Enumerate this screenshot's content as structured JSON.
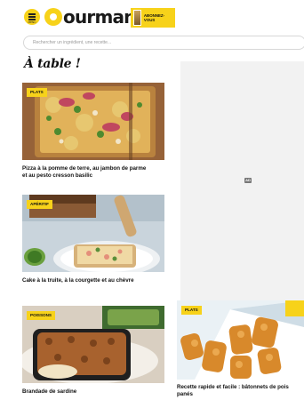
{
  "header": {
    "menu_label": "MENU",
    "logo_text": "ourmand",
    "subscribe_label": "ABONNEZ-VOUS"
  },
  "search": {
    "placeholder": "Rechercher un ingrédient, une recette..."
  },
  "section": {
    "title": "À table !"
  },
  "ad": {
    "badge": "AD"
  },
  "cards": [
    {
      "tag": "PLATS",
      "title_line1": "Pizza à la pomme de terre, au jambon de parme",
      "title_line2": "et au pesto cresson basilic"
    },
    {
      "tag": "APÉRITIF",
      "title_line1": "Cake à la truite, à la courgette et au chèvre",
      "title_line2": ""
    },
    {
      "tag": "POISSONS",
      "title_line1": "Brandade de sardine",
      "title_line2": ""
    },
    {
      "tag": "PLATS",
      "title_line1": "Recette rapide et facile : bâtonnets de pois",
      "title_line2": "panés"
    }
  ]
}
